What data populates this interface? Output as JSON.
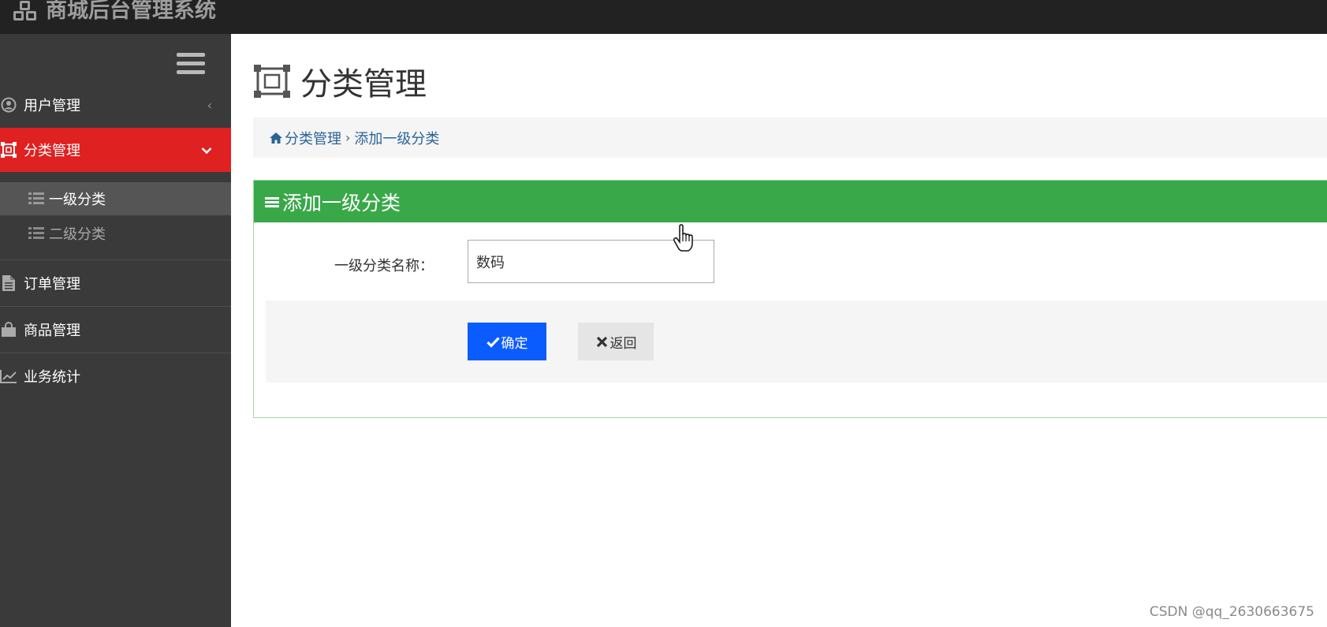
{
  "app": {
    "title": "商城后台管理系统"
  },
  "sidebar": {
    "items": [
      {
        "label": "用户管理",
        "icon": "user-circle-icon",
        "arrow": "‹"
      },
      {
        "label": "分类管理",
        "icon": "crop-frame-icon",
        "arrow": "⌄",
        "active": true
      },
      {
        "label": "订单管理",
        "icon": "document-icon"
      },
      {
        "label": "商品管理",
        "icon": "shopping-bag-icon"
      },
      {
        "label": "业务统计",
        "icon": "line-chart-icon"
      }
    ],
    "subitems": [
      {
        "label": "一级分类",
        "icon": "list-icon",
        "selected": true
      },
      {
        "label": "二级分类",
        "icon": "list-icon"
      }
    ]
  },
  "page": {
    "title": "分类管理",
    "breadcrumb": {
      "home": "分类管理",
      "separator": "›",
      "current": "添加一级分类"
    }
  },
  "panel": {
    "heading": "添加一级分类",
    "form": {
      "label": "一级分类名称：",
      "value": "数码"
    },
    "buttons": {
      "submit": "确定",
      "back": "返回"
    }
  },
  "watermark": "CSDN @qq_2630663675",
  "colors": {
    "topbar": "#222222",
    "sidebar": "#3a3a3a",
    "active_menu": "#e02121",
    "panel_heading": "#39a849",
    "primary_button": "#0b5cff"
  }
}
